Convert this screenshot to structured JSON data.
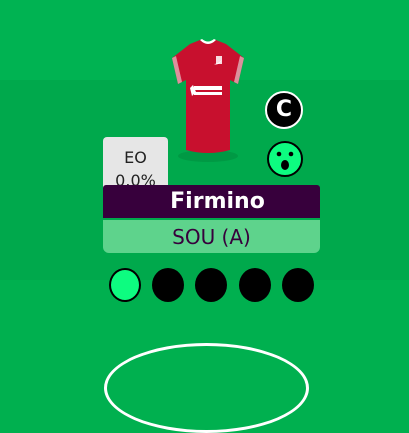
{
  "player": {
    "name": "Firmino",
    "fixture": "SOU (A)",
    "captain_badge": "C",
    "shirt_sponsor": "standard chartered"
  },
  "eo": {
    "label": "EO",
    "value": "0.0%"
  },
  "icons": {
    "shirt": "liverpool-shirt-icon",
    "captain": "captain-icon",
    "reaction": "surprised-face-icon"
  },
  "form_dots": [
    {
      "state": "active"
    },
    {
      "state": "inactive"
    },
    {
      "state": "inactive"
    },
    {
      "state": "inactive"
    },
    {
      "state": "inactive"
    }
  ],
  "colors": {
    "pitch": "#00b04f",
    "name_bar": "#37003c",
    "fixture_bar": "#5ed38c",
    "active_dot": "#0dfc80",
    "shirt": "#c8102e"
  }
}
